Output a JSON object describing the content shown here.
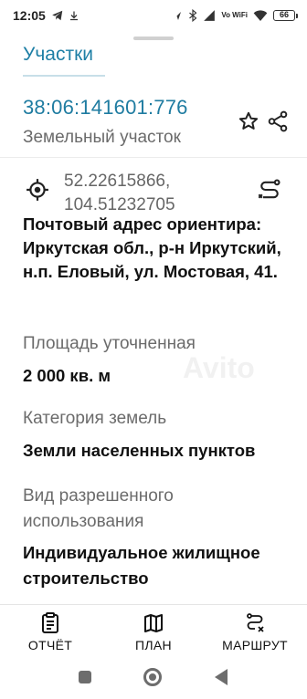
{
  "status_bar": {
    "time": "12:05",
    "network_label": "Vo WiFi",
    "battery": "66"
  },
  "header": {
    "breadcrumb": "Участки"
  },
  "parcel": {
    "cadastral_number": "38:06:141601:776",
    "type": "Земельный участок",
    "coordinates_line1": "52.22615866,",
    "coordinates_line2": "104.51232705",
    "address": "Почтовый адрес ориентира: Иркутская обл., р-н Иркутский, н.п. Еловый, ул. Мостовая,  41."
  },
  "details": {
    "area_label": "Площадь уточненная",
    "area_value": "2 000 кв. м",
    "category_label": "Категория земель",
    "category_value": "Земли населенных пунктов",
    "use_label": "Вид разрешенного использования",
    "use_value": "Индивидуальное жилищное строительство"
  },
  "bottom_nav": {
    "report_label": "ОТЧЁТ",
    "plan_label": "ПЛАН",
    "route_label": "МАРШРУТ"
  },
  "colors": {
    "accent": "#1e7fa5",
    "secondary_text": "#6b6b6b",
    "primary_text": "#111111"
  },
  "icons": [
    "star-icon",
    "share-icon",
    "gps-target-icon",
    "route-icon",
    "report-icon",
    "map-icon",
    "route-cancel-icon"
  ]
}
